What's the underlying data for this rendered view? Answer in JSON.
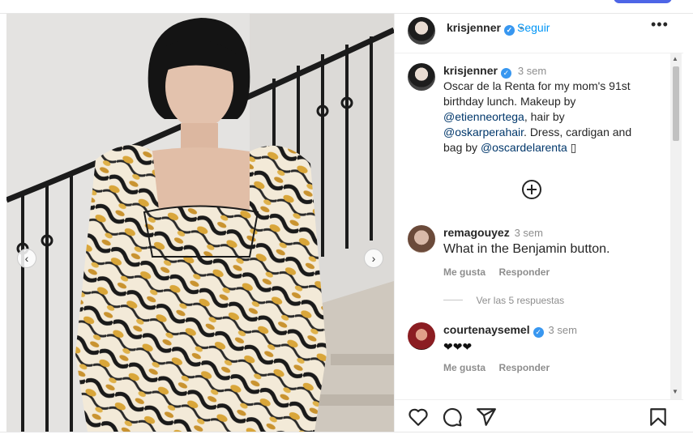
{
  "header": {
    "username": "krisjenner",
    "separator": "•",
    "follow_label": "Seguir",
    "more_label": "•••"
  },
  "caption": {
    "username": "krisjenner",
    "time": "3 sem",
    "line1": "Oscar de la Renta for my mom's 91st",
    "line2": "birthday lunch. Makeup by",
    "mention1": "@etienneortega",
    "after_mention1": ", hair by",
    "mention2": "@oskarperahair",
    "after_mention2": ". Dress, cardigan and",
    "line5_prefix": "bag by",
    "mention3": "@oscardelarenta",
    "line5_suffix": "▯"
  },
  "load_more_icon": "plus-circle-icon",
  "comments": [
    {
      "username": "remagouyez",
      "time": "3 sem",
      "text": "What in the Benjamin button.",
      "like_label": "Me gusta",
      "reply_label": "Responder",
      "view_replies": "Ver las 5 respuestas"
    },
    {
      "username": "courtenaysemel",
      "time": "3 sem",
      "text": "❤❤❤",
      "like_label": "Me gusta",
      "reply_label": "Responder"
    }
  ],
  "nav": {
    "prev": "‹",
    "next": "›"
  },
  "actions": {
    "icons": [
      "heart-icon",
      "comment-icon",
      "share-icon",
      "bookmark-icon"
    ]
  },
  "colors": {
    "link": "#00376b",
    "follow": "#0095f6",
    "verified": "#3897f0"
  }
}
